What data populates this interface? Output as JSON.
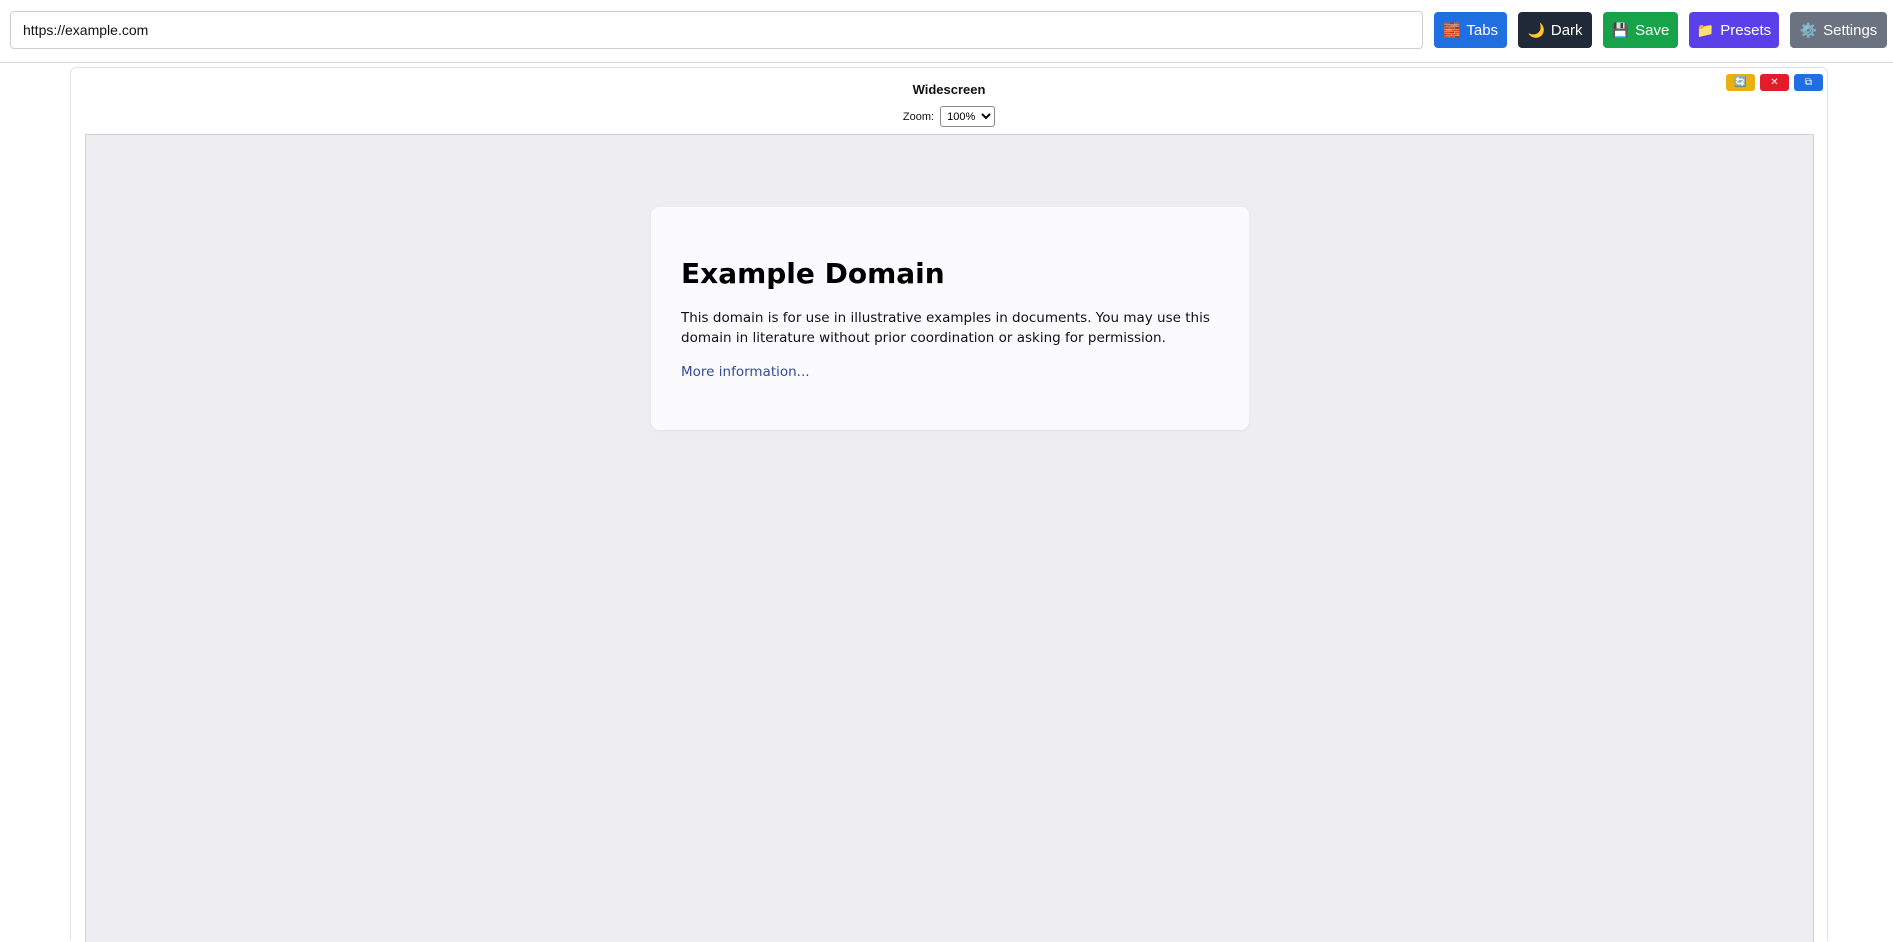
{
  "toolbar": {
    "url_value": "https://example.com",
    "buttons": {
      "tabs": {
        "icon": "🧱",
        "label": "Tabs",
        "color": "#1f6fe0"
      },
      "dark": {
        "icon": "🌙",
        "label": "Dark",
        "color": "#1f2937"
      },
      "save": {
        "icon": "💾",
        "label": "Save",
        "color": "#17a34a"
      },
      "presets": {
        "icon": "📁",
        "label": "Presets",
        "color": "#5b3fe8"
      },
      "settings": {
        "icon": "⚙️",
        "label": "Settings",
        "color": "#6b7280"
      }
    }
  },
  "device": {
    "title": "Widescreen",
    "zoom_label": "Zoom:",
    "zoom_value": "100%",
    "controls": {
      "rotate_icon": "🔄",
      "close_icon": "✕",
      "copy_icon": "⧉"
    }
  },
  "page": {
    "heading": "Example Domain",
    "body": "This domain is for use in illustrative examples in documents. You may use this domain in literature without prior coordination or asking for permission.",
    "link_text": "More information..."
  }
}
